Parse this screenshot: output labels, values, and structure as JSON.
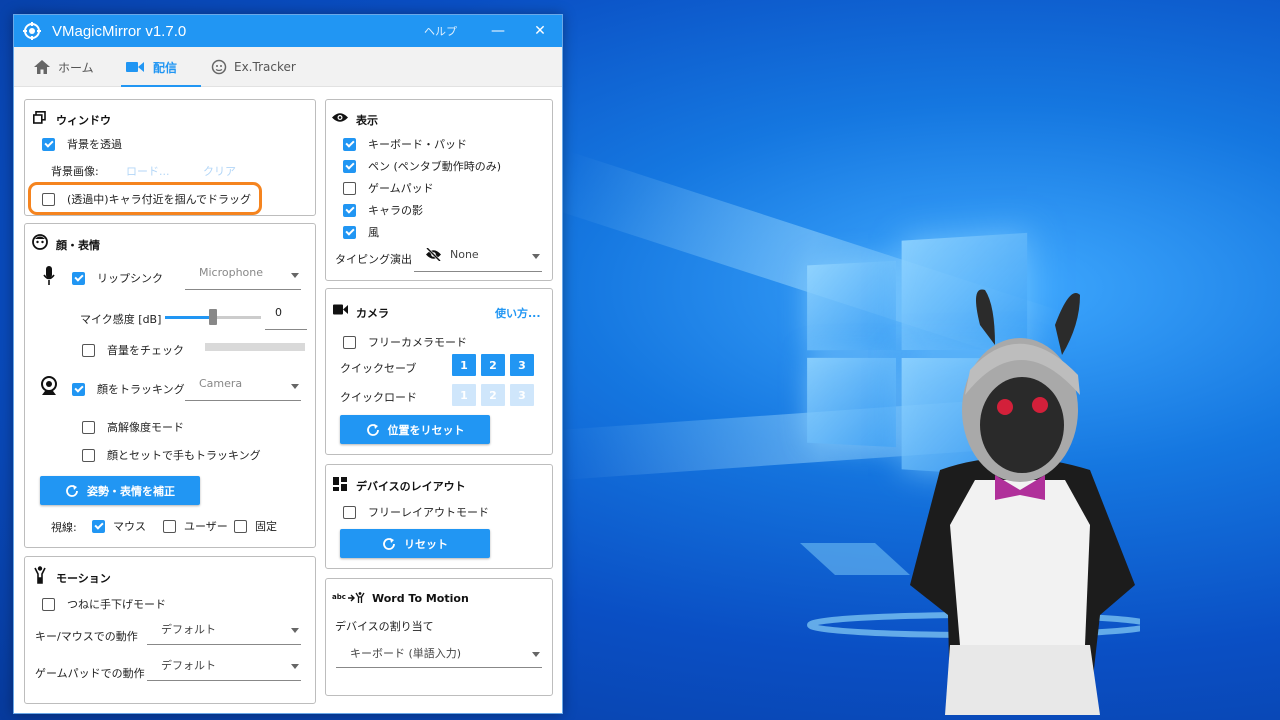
{
  "window": {
    "title": "VMagicMirror v1.7.0",
    "help_label": "ヘルプ"
  },
  "tabs": [
    {
      "label": "ホーム",
      "icon": "home-icon"
    },
    {
      "label": "配信",
      "icon": "video-camera-icon"
    },
    {
      "label": "Ex.Tracker",
      "icon": "face-tracker-icon"
    }
  ],
  "window_panel": {
    "title": "ウィンドウ",
    "transparent_bg": {
      "label": "背景を透過",
      "checked": true
    },
    "bg_image_label": "背景画像:",
    "load_link": "ロード...",
    "clear_link": "クリア",
    "drag": {
      "label": "(透過中)キャラ付近を掴んでドラッグ",
      "checked": false
    }
  },
  "face_panel": {
    "title": "顔・表情",
    "lipsync": {
      "label": "リップシンク",
      "checked": true,
      "device": "Microphone"
    },
    "mic_sensitivity": {
      "label": "マイク感度 [dB]",
      "value": "0"
    },
    "volume_check": {
      "label": "音量をチェック",
      "checked": false
    },
    "face_tracking": {
      "label": "顔をトラッキング",
      "checked": true,
      "device": "Camera"
    },
    "high_res": {
      "label": "高解像度モード",
      "checked": false
    },
    "hand_tracking": {
      "label": "顔とセットで手もトラッキング",
      "checked": false
    },
    "calibrate_button": "姿勢・表情を補正",
    "gaze_label": "視線:",
    "gaze_options": [
      {
        "label": "マウス",
        "checked": true
      },
      {
        "label": "ユーザー",
        "checked": false
      },
      {
        "label": "固定",
        "checked": false
      }
    ]
  },
  "motion_panel": {
    "title": "モーション",
    "hands_down": {
      "label": "つねに手下げモード",
      "checked": false
    },
    "key_mouse": {
      "label": "キー/マウスでの動作",
      "value": "デフォルト"
    },
    "gamepad": {
      "label": "ゲームパッドでの動作",
      "value": "デフォルト"
    }
  },
  "display_panel": {
    "title": "表示",
    "items": [
      {
        "label": "キーボード・パッド",
        "checked": true
      },
      {
        "label": "ペン (ペンタブ動作時のみ)",
        "checked": true
      },
      {
        "label": "ゲームパッド",
        "checked": false
      },
      {
        "label": "キャラの影",
        "checked": true
      },
      {
        "label": "風",
        "checked": true
      }
    ],
    "typing_label": "タイピング演出",
    "typing_value": "None"
  },
  "camera_panel": {
    "title": "カメラ",
    "help_link": "使い方...",
    "free_camera": {
      "label": "フリーカメラモード",
      "checked": false
    },
    "quick_save_label": "クイックセーブ",
    "quick_load_label": "クイックロード",
    "slots": [
      "1",
      "2",
      "3"
    ],
    "reset_button": "位置をリセット"
  },
  "device_panel": {
    "title": "デバイスのレイアウト",
    "free_layout": {
      "label": "フリーレイアウトモード",
      "checked": false
    },
    "reset_button": "リセット"
  },
  "word_panel": {
    "title": "Word To Motion",
    "title_prefix": "abc",
    "assign_label": "デバイスの割り当て",
    "assign_value": "キーボード (単語入力)"
  },
  "colors": {
    "accent": "#2196f3",
    "highlight": "#f5841f"
  }
}
